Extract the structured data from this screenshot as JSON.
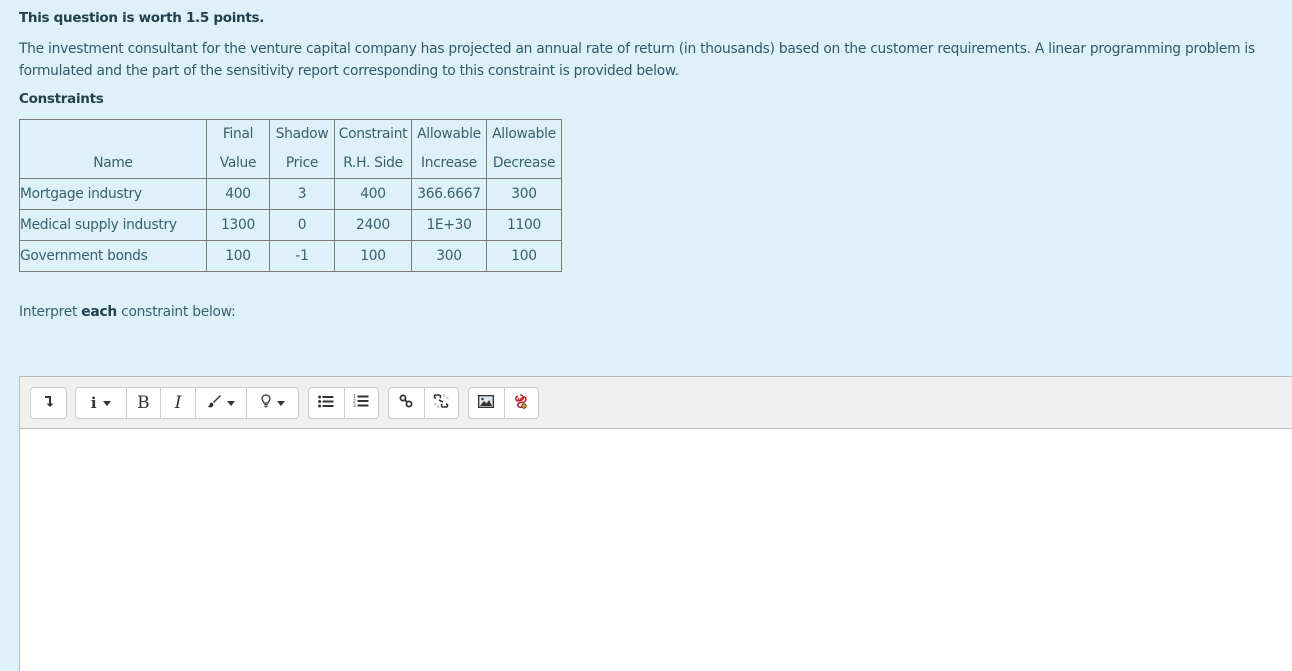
{
  "question": {
    "points_text": "This question is worth 1.5 points.",
    "prompt": "The investment consultant for the venture capital company has projected an annual rate of return (in thousands) based on the customer requirements. A linear programming problem is formulated and the part of the sensitivity report corresponding to this constraint is provided below.",
    "section_title": "Constraints",
    "instruction_pre": "Interpret ",
    "instruction_bold": "each",
    "instruction_post": " constraint below:"
  },
  "table": {
    "headers": [
      {
        "line1": "",
        "line2": "Name"
      },
      {
        "line1": "Final",
        "line2": "Value"
      },
      {
        "line1": "Shadow",
        "line2": "Price"
      },
      {
        "line1": "Constraint",
        "line2": "R.H. Side"
      },
      {
        "line1": "Allowable",
        "line2": "Increase"
      },
      {
        "line1": "Allowable",
        "line2": "Decrease"
      }
    ],
    "rows": [
      {
        "name": "Mortgage industry",
        "final_value": "400",
        "shadow_price": "3",
        "rhs": "400",
        "allow_increase": "366.6667",
        "allow_decrease": "300"
      },
      {
        "name": "Medical supply industry",
        "final_value": "1300",
        "shadow_price": "0",
        "rhs": "2400",
        "allow_increase": "1E+30",
        "allow_decrease": "1100"
      },
      {
        "name": "Government bonds",
        "final_value": "100",
        "shadow_price": "-1",
        "rhs": "100",
        "allow_increase": "300",
        "allow_decrease": "100"
      }
    ]
  },
  "editor": {
    "toolbar": [
      {
        "name": "toolbar-toggle",
        "icon": "arrow-down-to-line-icon",
        "glyph": "↴"
      },
      {
        "name": "paragraph-styles",
        "icon": "info-icon",
        "glyph": "i",
        "dropdown": true
      },
      {
        "name": "bold",
        "icon": "bold-icon",
        "glyph": "B"
      },
      {
        "name": "italic",
        "icon": "italic-icon",
        "glyph": "I"
      },
      {
        "name": "text-color",
        "icon": "paintbrush-icon",
        "dropdown": true
      },
      {
        "name": "highlight",
        "icon": "lightbulb-icon",
        "dropdown": true
      },
      {
        "name": "unordered-list",
        "icon": "bullet-list-icon"
      },
      {
        "name": "ordered-list",
        "icon": "numbered-list-icon"
      },
      {
        "name": "link",
        "icon": "link-icon"
      },
      {
        "name": "unlink",
        "icon": "unlink-icon"
      },
      {
        "name": "image",
        "icon": "image-icon"
      },
      {
        "name": "media",
        "icon": "media-icon"
      }
    ],
    "content": ""
  },
  "colors": {
    "background": "#def1f8",
    "heading": "#22404d",
    "text": "#37606e",
    "media_icon": "#c0262d"
  }
}
